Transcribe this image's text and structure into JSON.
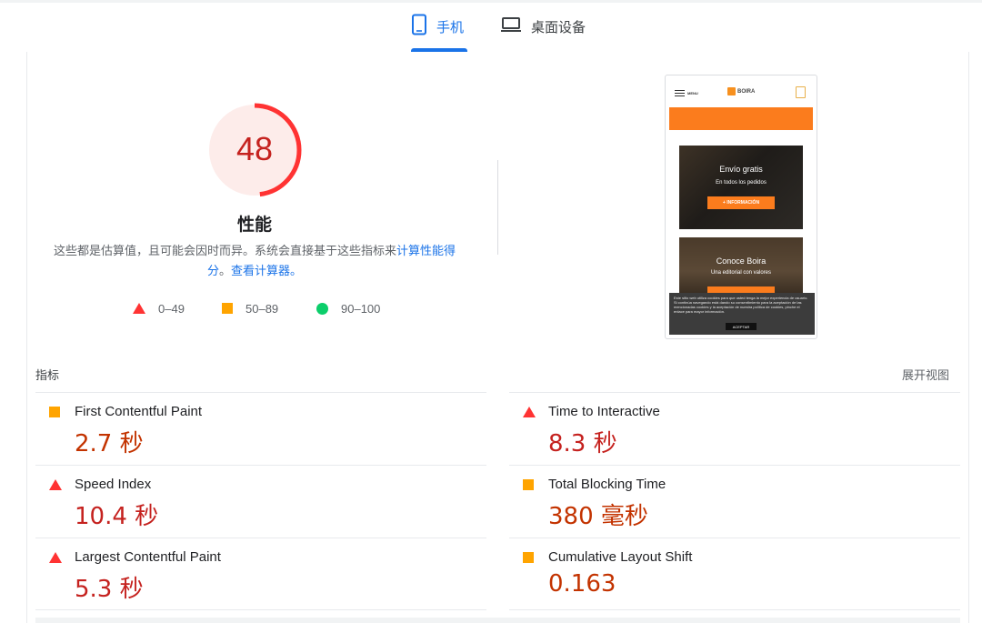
{
  "tabs": [
    {
      "label": "手机",
      "icon": "smartphone-icon",
      "active": true
    },
    {
      "label": "桌面设备",
      "icon": "laptop-icon",
      "active": false
    }
  ],
  "gauge": {
    "score": "48",
    "score_fraction": 0.48,
    "title": "性能",
    "color": "#ff3333",
    "background": "#fdecea"
  },
  "description": {
    "text": "这些都是估算值，且可能会因时而异。系统会直接基于这些指标来",
    "link1": "计算性能得分",
    "sep": "。",
    "link2": "查看计算器。"
  },
  "legend": [
    {
      "shape": "triangle",
      "label": "0–49",
      "color": "#ff3333"
    },
    {
      "shape": "square",
      "label": "50–89",
      "color": "#ffa400"
    },
    {
      "shape": "circle",
      "label": "90–100",
      "color": "#0cce6b"
    }
  ],
  "preview": {
    "menu_label": "MENU",
    "logo_text": "BOIRA",
    "promo1": {
      "title": "Envío gratis",
      "subtitle": "En todos los pedidos",
      "button": "+ INFORMACIÓN"
    },
    "promo2": {
      "title": "Conoce Boira",
      "subtitle": "Una editorial con valores"
    },
    "cookie": {
      "text": "Este sitio web utiliza cookies para que usted tenga la mejor experiencia de usuario. Si continúa navegando está dando su consentimiento para la aceptación de las mencionadas cookies y la aceptación de nuestra política de cookies, pinche el enlace para mayor información.",
      "button": "ACEPTAR"
    }
  },
  "metrics": {
    "header": "指标",
    "expand_label": "展开视图",
    "items": [
      {
        "label": "First Contentful Paint",
        "value": "2.7 秒",
        "rating": "average"
      },
      {
        "label": "Time to Interactive",
        "value": "8.3 秒",
        "rating": "fail"
      },
      {
        "label": "Speed Index",
        "value": "10.4 秒",
        "rating": "fail"
      },
      {
        "label": "Total Blocking Time",
        "value": "380 毫秒",
        "rating": "average"
      },
      {
        "label": "Largest Contentful Paint",
        "value": "5.3 秒",
        "rating": "fail"
      },
      {
        "label": "Cumulative Layout Shift",
        "value": "0.163",
        "rating": "average"
      }
    ]
  }
}
